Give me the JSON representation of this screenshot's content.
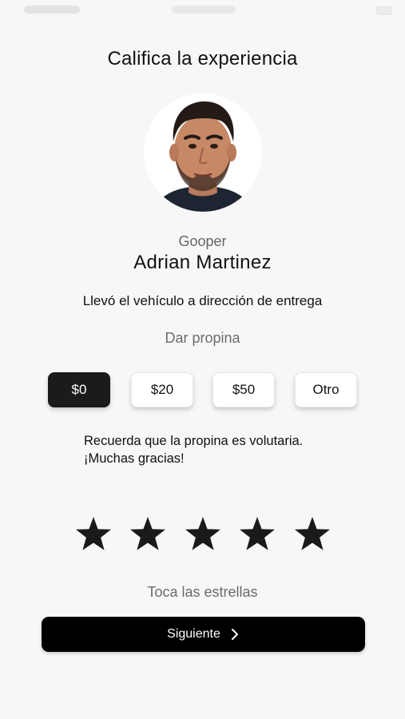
{
  "screen": {
    "title": "Califica la experiencia"
  },
  "driver": {
    "role": "Gooper",
    "name": "Adrian Martinez",
    "description": "Llevó el vehículo a dirección de entrega"
  },
  "tip": {
    "label": "Dar propina",
    "options": [
      {
        "label": "$0",
        "selected": true
      },
      {
        "label": "$20",
        "selected": false
      },
      {
        "label": "$50",
        "selected": false
      },
      {
        "label": "Otro",
        "selected": false
      }
    ],
    "note_line1": "Recuerda que la propina es volutaria.",
    "note_line2": "¡Muchas gracias!"
  },
  "rating": {
    "stars": 5,
    "hint": "Toca las estrellas"
  },
  "next_button": {
    "label": "Siguiente",
    "icon": "chevron-right-icon"
  },
  "colors": {
    "background": "#f7f7f7",
    "primary": "#000000",
    "selected_tip": "#1b1b1b",
    "muted_text": "#6b6b6b"
  }
}
